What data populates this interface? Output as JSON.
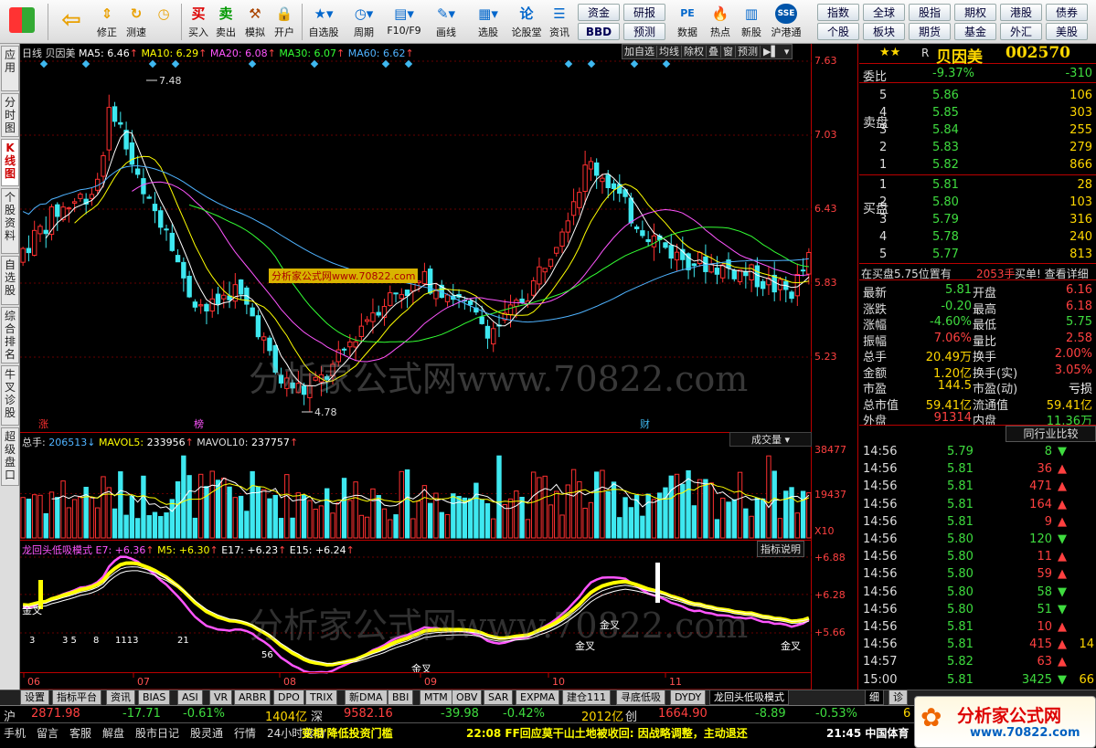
{
  "toolbar": {
    "items": [
      {
        "label": "",
        "icon": "windows-logo-icon",
        "x": 0
      },
      {
        "label": "",
        "icon": "back-arrow-icon",
        "x": 1
      },
      {
        "label": "修正",
        "icon": "updown-icon",
        "x": 2
      },
      {
        "label": "测速",
        "icon": "lightning-icon",
        "x": 3
      },
      {
        "label": "",
        "icon": "clock-icon",
        "x": 4
      },
      {
        "label": "买入",
        "icon": "buy-icon",
        "x": 5
      },
      {
        "label": "卖出",
        "icon": "sell-icon",
        "x": 6
      },
      {
        "label": "模拟",
        "icon": "hammer-icon",
        "x": 7
      },
      {
        "label": "开户",
        "icon": "lock-icon",
        "x": 8
      },
      {
        "label": "自选股",
        "icon": "star-icon",
        "x": 9
      },
      {
        "label": "周期",
        "icon": "cycle-icon",
        "x": 10
      },
      {
        "label": "F10/F9",
        "icon": "f10-icon",
        "x": 11
      },
      {
        "label": "画线",
        "icon": "pen-icon",
        "x": 12
      },
      {
        "label": "选股",
        "icon": "select-icon",
        "x": 13
      },
      {
        "label": "论股堂",
        "icon": "forum-icon",
        "x": 14
      },
      {
        "label": "资讯",
        "icon": "news-icon",
        "x": 15
      },
      {
        "label": "数据",
        "icon": "pe-icon",
        "x": 16
      },
      {
        "label": "热点",
        "icon": "hot-icon",
        "x": 17
      },
      {
        "label": "新股",
        "icon": "newstock-icon",
        "x": 18
      },
      {
        "label": "沪港通",
        "icon": "hk-icon",
        "x": 19
      }
    ],
    "nav_buttons": [
      "资金",
      "研报",
      "BBD",
      "预测",
      "指数",
      "全球",
      "股指",
      "期权",
      "港股",
      "债券",
      "个股",
      "板块",
      "期货",
      "基金",
      "外汇",
      "美股"
    ]
  },
  "left_tabs": [
    "应用",
    "分时图",
    "K线图",
    "个股资料",
    "自选股",
    "综合排名",
    "牛叉诊股",
    "超级盘口"
  ],
  "kline": {
    "period": "日线",
    "name": "贝因美",
    "ma": [
      {
        "label": "MA5: 6.46",
        "color": "#ffffff"
      },
      {
        "label": "MA10: 6.29",
        "color": "#ffff00"
      },
      {
        "label": "MA20: 6.08",
        "color": "#ff66ff"
      },
      {
        "label": "MA30: 6.07",
        "color": "#33ff33"
      },
      {
        "label": "MA60: 6.62",
        "color": "#4fb3ff"
      }
    ],
    "buttons": [
      "加自选",
      "均线",
      "除权",
      "叠",
      "窗",
      "预测"
    ],
    "y_ticks": [
      "7.63",
      "7.03",
      "6.43",
      "5.83",
      "5.23"
    ],
    "high_label": "7.48",
    "low_label": "4.78",
    "markers": [
      "涨",
      "榜",
      "财"
    ],
    "watermark": "分析家公式网www.70822.com",
    "watermark_small": "分析家公式网www.70822.com"
  },
  "volume": {
    "title": "总手: 206513↓ MAVOL5: 233956↑ MAVOL10: 237757↑",
    "label_total": "总手:",
    "val_total": "206513",
    "label_ma5": "MAVOL5:",
    "val_ma5": "233956",
    "label_ma10": "MAVOL10:",
    "val_ma10": "237757",
    "dropdown": "成交量",
    "y_ticks": [
      "38477",
      "19437",
      "X10"
    ]
  },
  "indicator": {
    "name": "龙回头低吸模式",
    "E7": "E7: +6.36",
    "M5": "M5: +6.30",
    "E17": "E17: +6.23",
    "E15": "E15: +6.24",
    "button": "指标说明",
    "y_ticks": [
      "+6.88",
      "+6.28",
      "+5.66"
    ],
    "labels": [
      "金叉",
      "金叉",
      "金叉",
      "金叉",
      "金叉",
      "3",
      "3 5",
      "8",
      "1113",
      "21",
      "56"
    ]
  },
  "x_axis": [
    "06",
    "07",
    "08",
    "09",
    "10",
    "11"
  ],
  "quote": {
    "stars": "★★",
    "code_label": "R",
    "name": "贝因美",
    "code": "002570",
    "wei_bi_label": "委比",
    "wei_bi": "-9.37%",
    "wei_cha": "-310",
    "sell_label": "卖盘",
    "buy_label": "买盘",
    "sell": [
      {
        "lv": "5",
        "p": "5.86",
        "v": "106"
      },
      {
        "lv": "4",
        "p": "5.85",
        "v": "303"
      },
      {
        "lv": "3",
        "p": "5.84",
        "v": "255"
      },
      {
        "lv": "2",
        "p": "5.83",
        "v": "279"
      },
      {
        "lv": "1",
        "p": "5.82",
        "v": "866"
      }
    ],
    "buy": [
      {
        "lv": "1",
        "p": "5.81",
        "v": "28"
      },
      {
        "lv": "2",
        "p": "5.80",
        "v": "103"
      },
      {
        "lv": "3",
        "p": "5.79",
        "v": "316"
      },
      {
        "lv": "4",
        "p": "5.78",
        "v": "240"
      },
      {
        "lv": "5",
        "p": "5.77",
        "v": "813"
      }
    ],
    "queue_text": "在买盘5.75位置有",
    "queue_num": "2053手",
    "queue_link": "买单! 查看详细",
    "stats": [
      [
        "最新",
        "5.81",
        "开盘",
        "6.16"
      ],
      [
        "涨跌",
        "-0.20",
        "最高",
        "6.18"
      ],
      [
        "涨幅",
        "-4.60%",
        "最低",
        "5.75"
      ],
      [
        "振幅",
        "7.06%",
        "量比",
        "2.58"
      ],
      [
        "总手",
        "20.49万",
        "换手",
        "2.00%"
      ],
      [
        "金额",
        "1.20亿",
        "换手(实)",
        "3.05%"
      ],
      [
        "市盈",
        "144.5",
        "市盈(动)",
        "亏损"
      ],
      [
        "总市值",
        "59.41亿",
        "流通值",
        "59.41亿"
      ],
      [
        "外盘",
        "91314",
        "内盘",
        "11.36万"
      ]
    ],
    "compare_btn": "同行业比较",
    "ticks": [
      [
        "14:56",
        "5.79",
        "8",
        "dn"
      ],
      [
        "14:56",
        "5.81",
        "36",
        "up"
      ],
      [
        "14:56",
        "5.81",
        "471",
        "up"
      ],
      [
        "14:56",
        "5.81",
        "164",
        "up"
      ],
      [
        "14:56",
        "5.81",
        "9",
        "up"
      ],
      [
        "14:56",
        "5.80",
        "120",
        "dn"
      ],
      [
        "14:56",
        "5.80",
        "11",
        "up"
      ],
      [
        "14:56",
        "5.80",
        "59",
        "up"
      ],
      [
        "14:56",
        "5.80",
        "58",
        "dn"
      ],
      [
        "14:56",
        "5.80",
        "51",
        "dn"
      ],
      [
        "14:56",
        "5.81",
        "10",
        "up"
      ],
      [
        "14:56",
        "5.81",
        "415",
        "up"
      ],
      [
        "14:57",
        "5.82",
        "63",
        "up"
      ],
      [
        "15:00",
        "5.81",
        "3425",
        "dn"
      ]
    ],
    "tick_tail": [
      "",
      "",
      "",
      "",
      "",
      "",
      "",
      "",
      "",
      "",
      "",
      "14",
      "",
      "66"
    ]
  },
  "bottom_tabs": [
    "设置",
    "指标平台",
    "资讯",
    "BIAS",
    "ASI",
    "VR",
    "ARBR",
    "DPO",
    "TRIX",
    "新DMA",
    "BBI",
    "MTM",
    "OBV",
    "SAR",
    "EXPMA",
    "建仓111",
    "寻底低吸",
    "DYDY",
    "龙回头低吸模式"
  ],
  "right_tabs": [
    "细",
    "诊"
  ],
  "index_bar": {
    "sh": "沪",
    "sh_val": "2871.98",
    "sh_chg": "-17.71",
    "sh_pct": "-0.61%",
    "sh_amt": "1404亿",
    "sz": "深",
    "sz_val": "9582.16",
    "sz_chg": "-39.98",
    "sz_pct": "-0.42%",
    "sz_amt": "2012亿",
    "cy": "创",
    "cy_val": "1664.90",
    "cy_chg": "-8.89",
    "cy_pct": "-0.53%",
    "cy_amt": "6"
  },
  "status": {
    "items": [
      "手机",
      "留言",
      "客服",
      "解盘",
      "股市日记",
      "股灵通",
      "行情",
      "24小时滚动"
    ],
    "news1": "变相'降低投资门槛",
    "news2": "22:08 FF回应莫干山土地被收回: 因战略调整，主动退还",
    "news3": "21:45 中国体育",
    "logo": "分析家公式网",
    "logo_url": "www.70822.com"
  },
  "colors": {
    "up": "#ff3030",
    "down": "#3ee8f0",
    "ma5": "#ffffff",
    "ma10": "#ffff00",
    "ma20": "#ff55ff",
    "ma30": "#33ff33",
    "ma60": "#4fb3ff"
  }
}
